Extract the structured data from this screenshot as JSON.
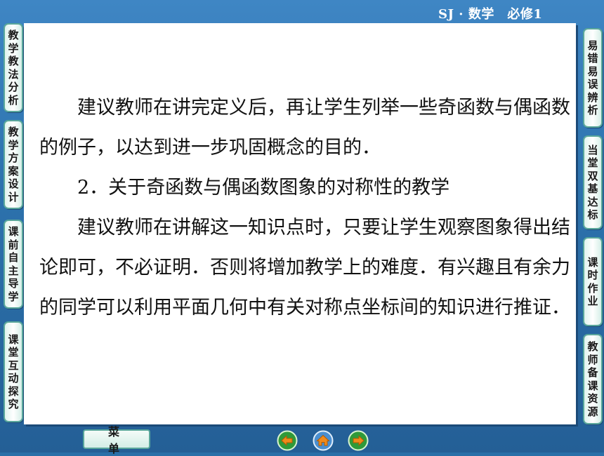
{
  "header": {
    "title": "SJ · 数学　必修1"
  },
  "left_tabs": [
    {
      "label": "教学教法分析"
    },
    {
      "label": "教学方案设计"
    },
    {
      "label": "课前自主导学"
    },
    {
      "label": "课堂互动探究"
    }
  ],
  "right_tabs": [
    {
      "label": "易错易误辨析"
    },
    {
      "label": "当堂双基达标"
    },
    {
      "label": "课时作业"
    },
    {
      "label": "教师备课资源"
    }
  ],
  "content": {
    "para1": "建议教师在讲完定义后，再让学生列举一些奇函数与偶函数的例子，以达到进一步巩固概念的目的．",
    "heading2": "2．关于奇函数与偶函数图象的对称性的教学",
    "para2": "建议教师在讲解这一知识点时，只要让学生观察图象得出结论即可，不必证明．否则将增加教学上的难度．有兴趣且有余力的同学可以利用平面几何中有关对称点坐标间的知识进行推证．"
  },
  "footer": {
    "menu_label": "菜单",
    "nav_icons": [
      "back-arrow-icon",
      "home-icon",
      "forward-arrow-icon"
    ]
  },
  "colors": {
    "background": "#2d73ae",
    "tab_border": "#5aa79b",
    "nav_icon": "#f08a1c"
  }
}
